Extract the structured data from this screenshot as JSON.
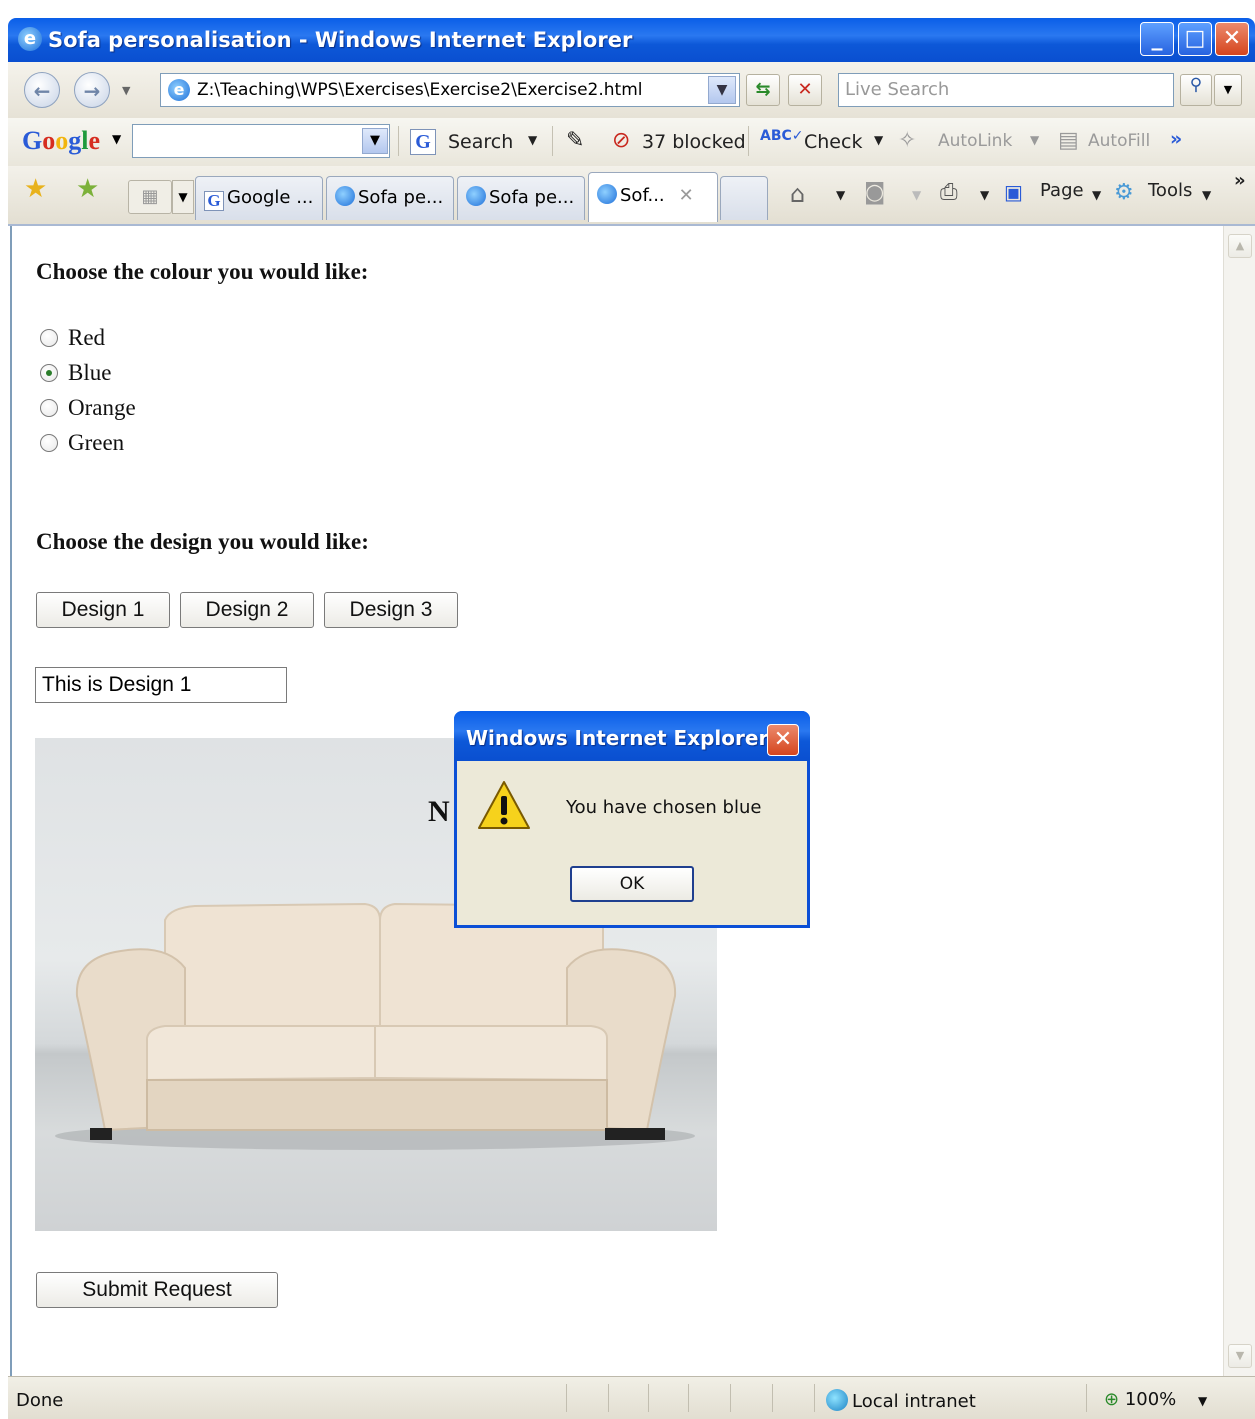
{
  "window": {
    "title": "Sofa personalisation - Windows Internet Explorer",
    "buttons": {
      "minimize": "_",
      "maximize": "□",
      "close": "✕"
    }
  },
  "address_bar": {
    "url": "Z:\\Teaching\\WPS\\Exercises\\Exercise2\\Exercise2.html",
    "search_placeholder": "Live Search"
  },
  "google_toolbar": {
    "logo": "Google",
    "search_label": "Search",
    "popup_blocked": "37 blocked",
    "check_label": "Check",
    "autolink_label": "AutoLink",
    "autofill_label": "AutoFill",
    "more": "»"
  },
  "tabs": [
    {
      "label": "Google ...",
      "icon": "google-icon"
    },
    {
      "label": "Sofa pe...",
      "icon": "ie-icon"
    },
    {
      "label": "Sofa pe...",
      "icon": "ie-icon"
    },
    {
      "label": "Sof...",
      "icon": "ie-icon",
      "active": true
    }
  ],
  "command_bar": {
    "page_label": "Page",
    "tools_label": "Tools",
    "more": "»"
  },
  "page": {
    "colour_heading": "Choose the colour you would like:",
    "colours": [
      {
        "label": "Red",
        "checked": false
      },
      {
        "label": "Blue",
        "checked": true
      },
      {
        "label": "Orange",
        "checked": false
      },
      {
        "label": "Green",
        "checked": false
      }
    ],
    "design_heading": "Choose the design you would like:",
    "design_buttons": [
      "Design 1",
      "Design 2",
      "Design 3"
    ],
    "design_text": "This is Design 1",
    "image_heading_partial": "N",
    "submit_label": "Submit Request"
  },
  "dialog": {
    "title": "Windows Internet Explorer",
    "message": "You have chosen blue",
    "ok_label": "OK"
  },
  "status_bar": {
    "status": "Done",
    "zone": "Local intranet",
    "zoom": "100%"
  },
  "colors": {
    "titlebar_blue": "#0a5ee8",
    "close_red": "#d5451e",
    "dialog_bg": "#ece9d8"
  }
}
